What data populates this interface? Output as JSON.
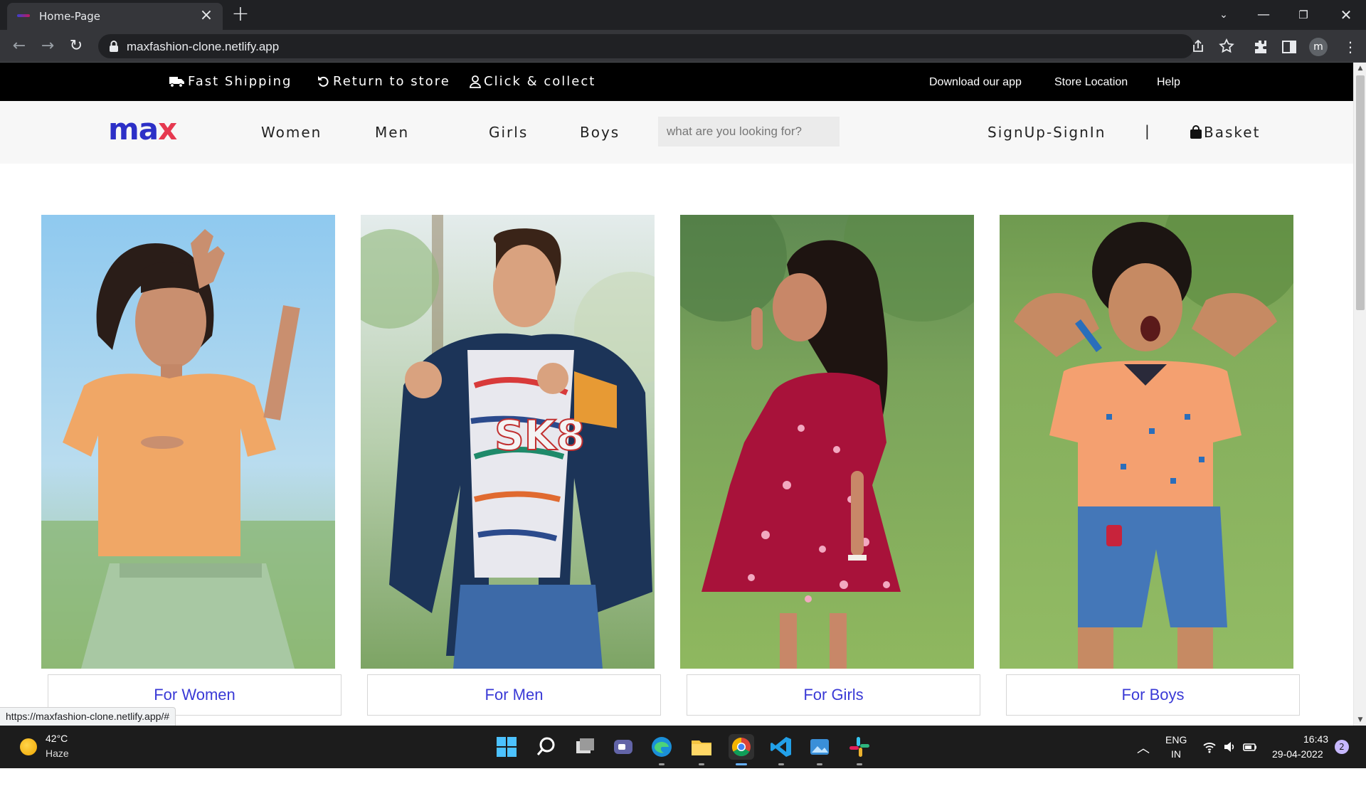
{
  "browser": {
    "tab_title": "Home-Page",
    "url": "maxfashion-clone.netlify.app",
    "profile_initial": "m",
    "status_url": "https://maxfashion-clone.netlify.app/#"
  },
  "topstrip": {
    "perks": [
      "Fast Shipping",
      "Return to store",
      "Click & collect"
    ],
    "links": [
      "Download our app",
      "Store Location",
      "Help"
    ]
  },
  "nav": {
    "logo_text": "max",
    "items": [
      "Women",
      "Men",
      "Girls",
      "Boys"
    ],
    "search_placeholder": "what are you looking for?",
    "signin": "SignUp-SignIn",
    "separator": "|",
    "basket": "Basket"
  },
  "categories": [
    {
      "label": "For Women",
      "image": "woman-in-orange-top"
    },
    {
      "label": "For Men",
      "image": "man-in-navy-jacket"
    },
    {
      "label": "For Girls",
      "image": "girl-in-red-floral-dress"
    },
    {
      "label": "For Boys",
      "image": "boy-in-orange-polo"
    }
  ],
  "taskbar": {
    "temperature": "42°C",
    "condition": "Haze",
    "lang_1": "ENG",
    "lang_2": "IN",
    "time": "16:43",
    "date": "29-04-2022",
    "notifications": "2"
  },
  "colors": {
    "brand_blue": "#2c2fc7",
    "brand_red": "#e63950",
    "category_link": "#3a3ad6"
  }
}
